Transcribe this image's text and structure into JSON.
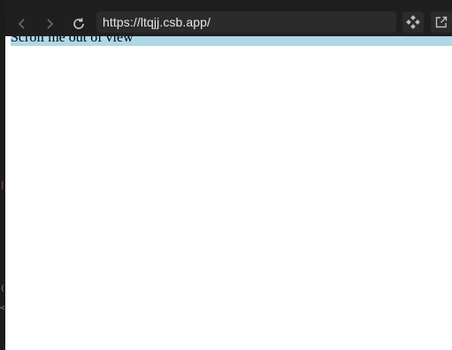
{
  "browser": {
    "url": "https://ltqjj.csb.app/",
    "back_icon": "chevron-left-icon",
    "forward_icon": "chevron-right-icon",
    "reload_icon": "reload-icon",
    "extension_icon": "diamond-cluster-icon",
    "open_new_window_icon": "external-window-icon"
  },
  "page": {
    "banner_text": "Scroll me out of view",
    "banner_color": "#add8e6",
    "background_color": "#ffffff"
  },
  "colors": {
    "chrome_bg": "#1f1f1f",
    "urlbar_bg": "#2b2b2b",
    "gutter_accent_pink": "#c05070"
  }
}
